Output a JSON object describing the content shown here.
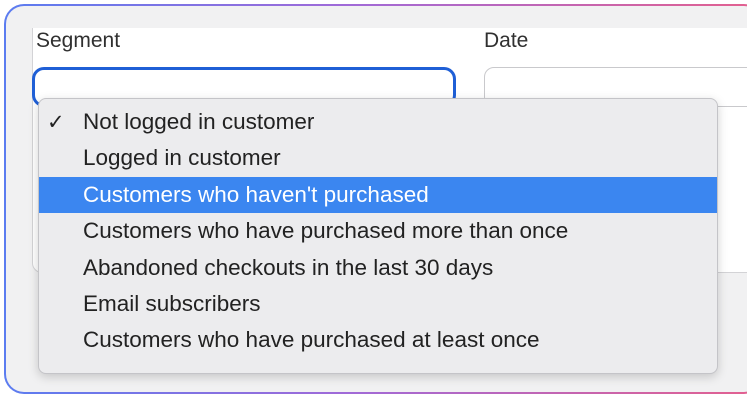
{
  "form": {
    "segment_label": "Segment",
    "date_label": "Date"
  },
  "dropdown": {
    "checkmark_glyph": "✓",
    "options": [
      {
        "label": "Not logged in customer",
        "selected": true,
        "highlighted": false
      },
      {
        "label": "Logged in customer",
        "selected": false,
        "highlighted": false
      },
      {
        "label": "Customers who haven't purchased",
        "selected": false,
        "highlighted": true
      },
      {
        "label": "Customers who have purchased more than once",
        "selected": false,
        "highlighted": false
      },
      {
        "label": "Abandoned checkouts in the last 30 days",
        "selected": false,
        "highlighted": false
      },
      {
        "label": "Email subscribers",
        "selected": false,
        "highlighted": false
      },
      {
        "label": "Customers who have purchased at least once",
        "selected": false,
        "highlighted": false
      }
    ]
  },
  "colors": {
    "highlight": "#3b86f0",
    "focus_ring": "#1f5fd6",
    "frame_gradient_start": "#5b7cf0",
    "frame_gradient_end": "#e4608e"
  }
}
